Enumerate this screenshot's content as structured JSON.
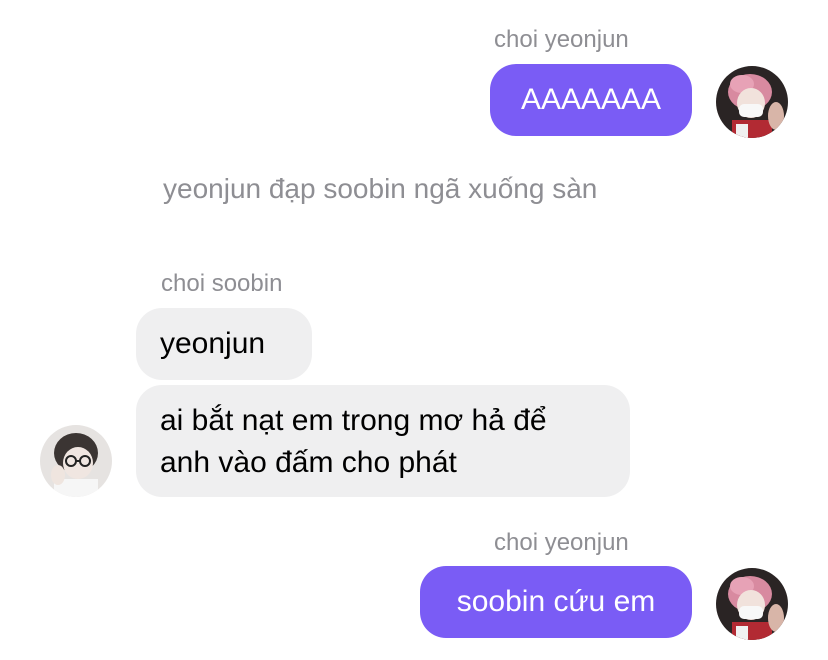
{
  "messages": [
    {
      "sender": "choi yeonjun",
      "text": "AAAAAAA"
    },
    {
      "system_text": "yeonjun đạp soobin ngã xuống sàn"
    },
    {
      "sender": "choi soobin",
      "text": "yeonjun"
    },
    {
      "text_line1": "ai bắt nạt em trong mơ hả để",
      "text_line2": "anh vào đấm cho phát"
    },
    {
      "sender": "choi yeonjun",
      "text": "soobin cứu em"
    }
  ],
  "colors": {
    "outgoing_bubble": "#7a5cf5",
    "incoming_bubble": "#efeff0",
    "meta_text": "#8e8e93"
  },
  "icons": {
    "yeonjun_avatar": "user-avatar-pink-hair-icon",
    "soobin_avatar": "user-avatar-glasses-icon"
  }
}
